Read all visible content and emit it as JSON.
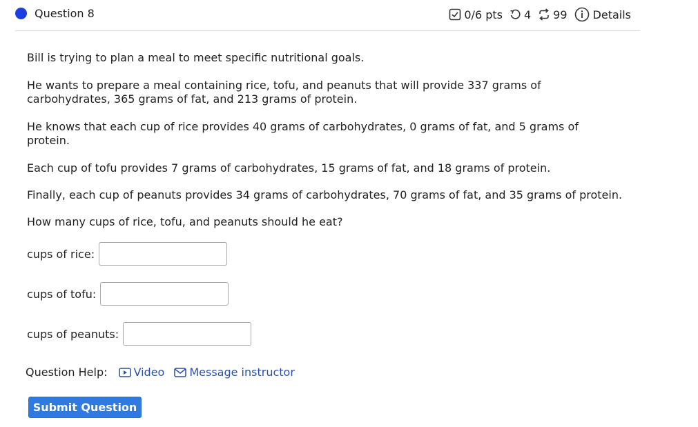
{
  "header": {
    "question_title": "Question 8",
    "points": "0/6 pts",
    "attempts": "4",
    "versions": "99",
    "details_label": "Details",
    "icons": [
      "checkbox-icon",
      "retry-icon",
      "versions-icon",
      "info-icon"
    ],
    "status_dot_color": "#1d3fe0"
  },
  "question": {
    "paragraphs": [
      "Bill is trying to plan a meal to meet specific nutritional goals.",
      "He wants to prepare a meal containing rice, tofu, and peanuts that will provide 337 grams of carbohydrates, 365 grams of fat, and 213 grams of protein.",
      "He knows that each cup of rice provides 40 grams of carbohydrates, 0 grams of fat, and 5 grams of protein.",
      "Each cup of tofu provides  7 grams of carbohydrates, 15 grams of fat, and 18 grams of protein.",
      "Finally, each cup of peanuts provides  34 grams of carbohydrates, 70 grams of fat, and 35 grams of protein.",
      "How many cups of rice, tofu, and peanuts should he eat?"
    ]
  },
  "answers": {
    "rice_label": "cups of rice:",
    "rice_value": "",
    "tofu_label": "cups of tofu:",
    "tofu_value": "",
    "peanuts_label": "cups of peanuts:",
    "peanuts_value": ""
  },
  "help": {
    "label": "Question Help:",
    "video_label": "Video",
    "message_label": "Message instructor",
    "link_color": "#2b4fa8"
  },
  "submit": {
    "label": "Submit Question",
    "color": "#2e7ae0"
  }
}
